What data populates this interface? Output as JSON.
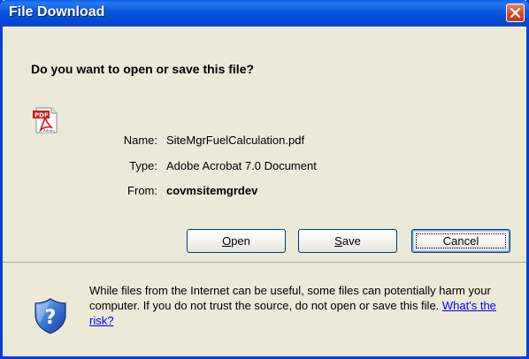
{
  "window": {
    "title": "File Download"
  },
  "dialog": {
    "question": "Do you want to open or save this file?",
    "file_icon": "pdf-file-icon",
    "name_label": "Name:",
    "name_value": "SiteMgrFuelCalculation.pdf",
    "type_label": "Type:",
    "type_value": "Adobe Acrobat 7.0 Document",
    "from_label": "From:",
    "from_value": "covmsitemgrdev"
  },
  "buttons": {
    "open_mnemonic": "O",
    "open_rest": "pen",
    "save_mnemonic": "S",
    "save_rest": "ave",
    "cancel_label": "Cancel"
  },
  "warning": {
    "icon": "shield-question-icon",
    "text": "While files from the Internet can be useful, some files can potentially harm your computer. If you do not trust the source, do not open or save this file.",
    "link": "What's the risk?"
  },
  "colors": {
    "titlebar": "#0855dd",
    "dialog_bg": "#ece9d8",
    "close_button": "#d64520",
    "link": "#0000ff"
  }
}
